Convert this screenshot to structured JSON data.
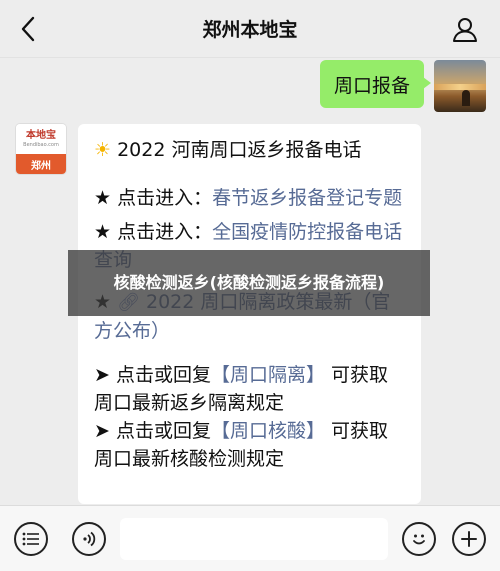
{
  "header": {
    "title": "郑州本地宝",
    "back_icon": "chevron-left-icon",
    "profile_icon": "person-icon"
  },
  "outgoing": {
    "text": "周口报备"
  },
  "bot_avatar": {
    "name": "本地宝",
    "sub": "Bendibao.com",
    "city": "郑州"
  },
  "incoming": {
    "title_emoji": "☀",
    "title": "2022 河南周口返乡报备电话",
    "item1_prefix": "★ 点击进入：",
    "item1_link": "春节返乡报备登记专题",
    "item2_prefix": "★ 点击进入：",
    "item2_link": "全国疫情防控报备电话查询",
    "item3_prefix": "★",
    "item3_link": "2022 周口隔离政策最新（官方公布）",
    "item4_a": "➤ 点击或回复",
    "item4_b": "【周口隔离】",
    "item4_c": "可获取周口最新返乡隔离规定",
    "item5_a": "➤ 点击或回复",
    "item5_b": "【周口核酸】",
    "item5_c": "可获取周口最新核酸检测规定"
  },
  "overlay": {
    "text": "核酸检测返乡(核酸检测返乡报备流程)"
  },
  "toolbar": {
    "menu_icon": "menu-list-icon",
    "voice_icon": "voice-icon",
    "emoji_icon": "emoji-icon",
    "plus_icon": "plus-icon",
    "input_value": ""
  },
  "colors": {
    "green_bubble": "#95ec69",
    "link": "#576b95",
    "background": "#ededed"
  }
}
